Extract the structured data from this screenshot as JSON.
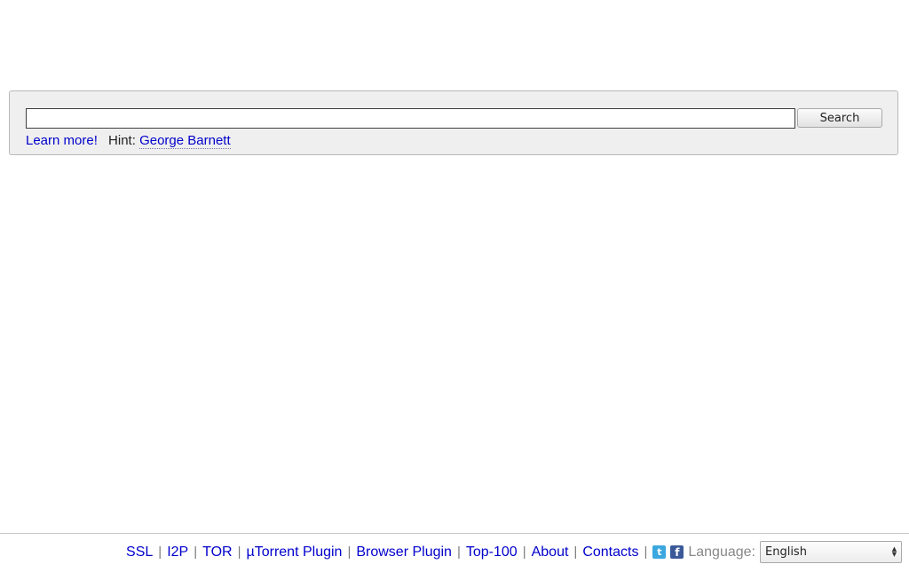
{
  "search": {
    "value": "",
    "placeholder": "",
    "button_label": "Search",
    "learn_more": "Learn more!",
    "hint_label": "Hint:",
    "hint_value": "George Barnett"
  },
  "footer": {
    "links": {
      "ssl": "SSL",
      "i2p": "I2P",
      "tor": "TOR",
      "utorrent": "µTorrent Plugin",
      "browser": "Browser Plugin",
      "top100": "Top-100",
      "about": "About",
      "contacts": "Contacts"
    },
    "separator": "|",
    "twitter_glyph": "t",
    "facebook_glyph": "f",
    "language_label": "Language:",
    "language_selected": "English"
  },
  "icons": {
    "twitter": "twitter-icon",
    "facebook": "facebook-icon",
    "select_arrows": "select-arrows-icon"
  },
  "colors": {
    "link": "#0000cc",
    "panel_bg": "#efefef",
    "twitter": "#3aa8df",
    "facebook": "#3b5998"
  }
}
